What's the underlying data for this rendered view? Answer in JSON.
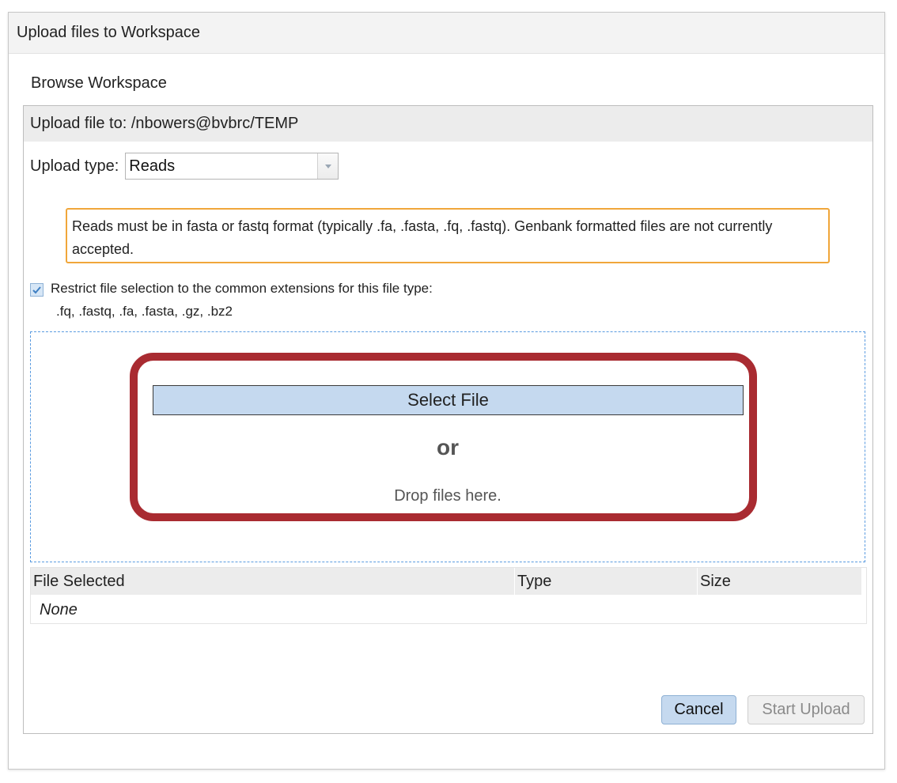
{
  "dialog": {
    "title": "Upload files to Workspace",
    "browse_label": "Browse Workspace"
  },
  "upload_panel": {
    "header": "Upload file to: /nbowers@bvbrc/TEMP",
    "upload_type_label": "Upload type:",
    "upload_type_value": "Reads",
    "notice": "Reads must be in fasta or fastq format (typically .fa, .fasta, .fq, .fastq). Genbank formatted files are not currently accepted.",
    "restrict": {
      "checked": true,
      "label": "Restrict file selection to the common extensions for this file type:",
      "extensions": ".fq, .fastq, .fa, .fasta, .gz, .bz2"
    },
    "dropzone": {
      "select_button": "Select File",
      "or_text": "or",
      "drop_text": "Drop files here."
    },
    "file_table": {
      "columns": [
        "File Selected",
        "Type",
        "Size"
      ],
      "empty_text": "None"
    },
    "actions": {
      "cancel": "Cancel",
      "start_upload": "Start Upload"
    }
  },
  "colors": {
    "notice_border": "#f0a63a",
    "highlight_ring": "#a92b31",
    "primary_button": "#c5d9ef",
    "dropzone_border": "#5a9be0"
  }
}
